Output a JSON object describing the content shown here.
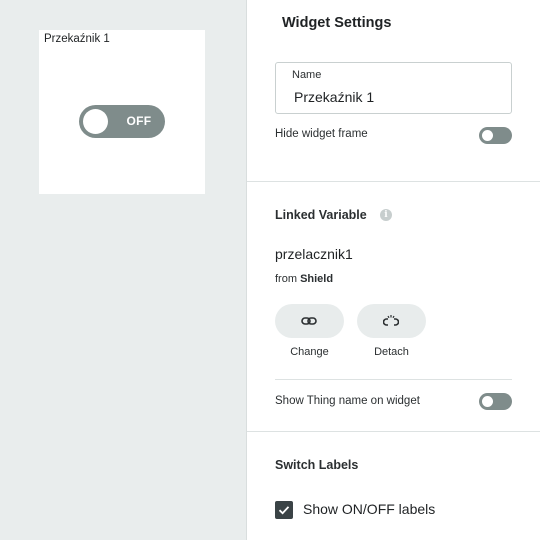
{
  "widget": {
    "title": "Przekaźnik 1",
    "state_label": "OFF"
  },
  "settings": {
    "title": "Widget Settings",
    "name_label": "Name",
    "name_value": "Przekaźnik 1",
    "hide_frame_label": "Hide widget frame",
    "hide_frame_on": false
  },
  "linked_variable": {
    "title": "Linked Variable",
    "info_icon": "i",
    "variable_name": "przelacznik1",
    "from_prefix": "from",
    "thing_name": "Shield",
    "change_label": "Change",
    "detach_label": "Detach",
    "show_thing_label": "Show Thing name on widget",
    "show_thing_on": false
  },
  "switch_labels": {
    "title": "Switch Labels",
    "show_labels_text": "Show ON/OFF labels",
    "show_labels_checked": true
  },
  "colors": {
    "toggle_off": "#7f8c8b",
    "canvas_bg": "#e9eded",
    "checkbox": "#3a4346"
  },
  "icons": {
    "change": "link-icon",
    "detach": "unlink-icon",
    "info": "info-icon",
    "check": "check-icon"
  }
}
